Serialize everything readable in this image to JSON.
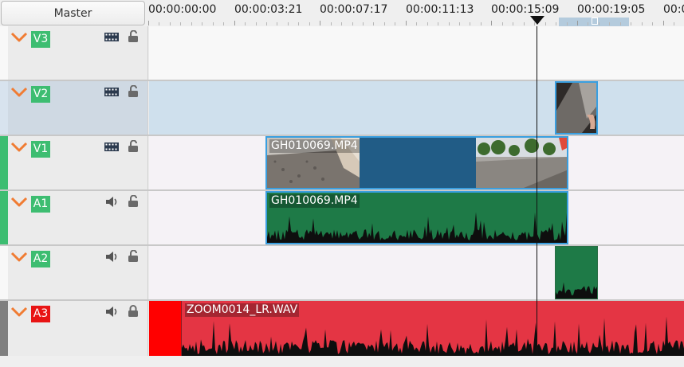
{
  "header": {
    "master_label": "Master",
    "timecodes": [
      "00:00:00:00",
      "00:00:03:21",
      "00:00:07:17",
      "00:00:11:13",
      "00:00:15:09",
      "00:00:19:05",
      "00:0"
    ]
  },
  "tracks": [
    {
      "name": "V3",
      "kind": "video",
      "locked": false
    },
    {
      "name": "V2",
      "kind": "video",
      "locked": false
    },
    {
      "name": "V1",
      "kind": "video",
      "locked": false
    },
    {
      "name": "A1",
      "kind": "audio",
      "locked": false
    },
    {
      "name": "A2",
      "kind": "audio",
      "locked": false
    },
    {
      "name": "A3",
      "kind": "audio",
      "locked": true
    }
  ],
  "clips": {
    "v1_clip": "GH010069.MP4",
    "a1_clip": "GH010069.MP4",
    "a3_clip": "ZOOM0014_LR.WAV"
  },
  "icons": {
    "collapse": "chevron-down-icon",
    "video": "film-strip-icon",
    "audio": "speaker-icon",
    "lock": "lock-icon"
  },
  "colors": {
    "video_name_bg": "#3dbd71",
    "audio_name_bg": "#3dbd71",
    "a3_name_bg": "#e81414",
    "selected_clip_border": "#3a9fe0",
    "video_clip_bg": "#215c86",
    "audio_clip_bg": "#1e7a47",
    "a3_clip_bg": "#e43544",
    "chevron": "#f07c33"
  }
}
